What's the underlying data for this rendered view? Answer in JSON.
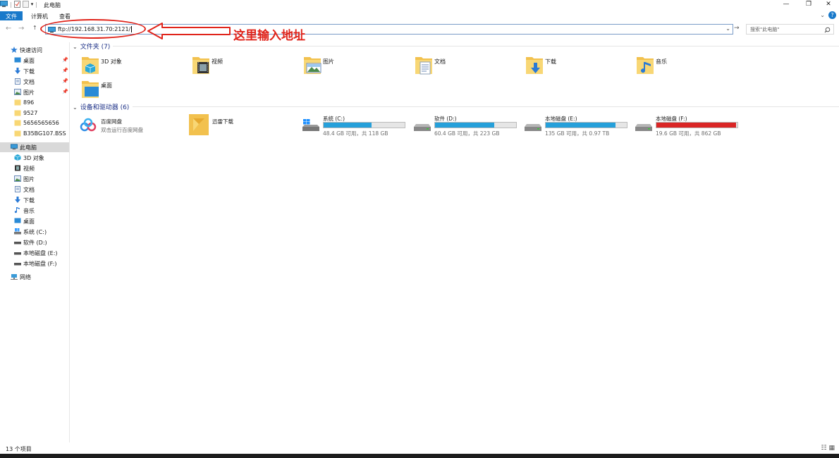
{
  "window": {
    "title": "此电脑",
    "controls": {
      "minimize": "—",
      "maximize": "❐",
      "close": "✕"
    }
  },
  "ribbon": {
    "tabs": [
      "文件",
      "计算机",
      "查看"
    ],
    "help": "?",
    "collapse": "⌄"
  },
  "navigation": {
    "back": "←",
    "forward": "→",
    "up": "↑",
    "address": "ftp://192.168.31.70:2121/",
    "dropdown": "⌄",
    "go": "→",
    "search_placeholder": "搜索\"此电脑\"",
    "search_icon": "search-icon"
  },
  "annotation": {
    "text": "这里输入地址",
    "color": "#e0241b"
  },
  "sidebar": {
    "quick_access": {
      "label": "快速访问",
      "items": [
        {
          "label": "桌面",
          "pinned": true,
          "icon": "desktop-icon"
        },
        {
          "label": "下载",
          "pinned": true,
          "icon": "download-icon"
        },
        {
          "label": "文档",
          "pinned": true,
          "icon": "document-icon"
        },
        {
          "label": "图片",
          "pinned": true,
          "icon": "picture-icon"
        },
        {
          "label": "896",
          "pinned": false,
          "icon": "folder-icon"
        },
        {
          "label": "9527",
          "pinned": false,
          "icon": "folder-icon"
        },
        {
          "label": "5656565656",
          "pinned": false,
          "icon": "folder-icon"
        },
        {
          "label": "B35BG107.BSS",
          "pinned": false,
          "icon": "folder-icon"
        }
      ]
    },
    "this_pc": {
      "label": "此电脑",
      "items": [
        {
          "label": "3D 对象",
          "icon": "3d-objects-icon"
        },
        {
          "label": "视频",
          "icon": "video-icon"
        },
        {
          "label": "图片",
          "icon": "picture-icon"
        },
        {
          "label": "文档",
          "icon": "document-icon"
        },
        {
          "label": "下载",
          "icon": "download-icon"
        },
        {
          "label": "音乐",
          "icon": "music-icon"
        },
        {
          "label": "桌面",
          "icon": "desktop-icon"
        },
        {
          "label": "系统 (C:)",
          "icon": "windows-drive-icon"
        },
        {
          "label": "软件 (D:)",
          "icon": "drive-icon"
        },
        {
          "label": "本地磁盘 (E:)",
          "icon": "drive-icon"
        },
        {
          "label": "本地磁盘 (F:)",
          "icon": "drive-icon"
        }
      ]
    },
    "network": {
      "label": "网络",
      "icon": "network-icon"
    }
  },
  "folders": {
    "header": "文件夹 (7)",
    "items": [
      {
        "label": "3D 对象",
        "icon": "3d-objects-folder-icon"
      },
      {
        "label": "视频",
        "icon": "video-folder-icon"
      },
      {
        "label": "图片",
        "icon": "picture-folder-icon"
      },
      {
        "label": "文档",
        "icon": "document-folder-icon"
      },
      {
        "label": "下载",
        "icon": "download-folder-icon"
      },
      {
        "label": "音乐",
        "icon": "music-folder-icon"
      },
      {
        "label": "桌面",
        "icon": "desktop-folder-icon"
      }
    ]
  },
  "devices": {
    "header": "设备和驱动器 (6)",
    "apps": [
      {
        "name": "百度网盘",
        "subtitle": "双击运行百度网盘",
        "icon": "baidu-netdisk-icon"
      },
      {
        "name": "迅雷下载",
        "icon": "thunder-download-icon"
      }
    ],
    "drives": [
      {
        "name": "系统 (C:)",
        "info": "48.4 GB 可用，共 118 GB",
        "used_fraction": 0.59,
        "bar_color": "#26a0da",
        "icon": "windows-drive-icon"
      },
      {
        "name": "软件 (D:)",
        "info": "60.4 GB 可用，共 223 GB",
        "used_fraction": 0.73,
        "bar_color": "#26a0da",
        "icon": "drive-icon"
      },
      {
        "name": "本地磁盘 (E:)",
        "info": "135 GB 可用，共 0.97 TB",
        "used_fraction": 0.86,
        "bar_color": "#26a0da",
        "icon": "drive-icon"
      },
      {
        "name": "本地磁盘 (F:)",
        "info": "19.6 GB 可用，共 862 GB",
        "used_fraction": 0.98,
        "bar_color": "#da2626",
        "icon": "drive-icon"
      }
    ]
  },
  "status": {
    "item_count": "13 个项目"
  }
}
